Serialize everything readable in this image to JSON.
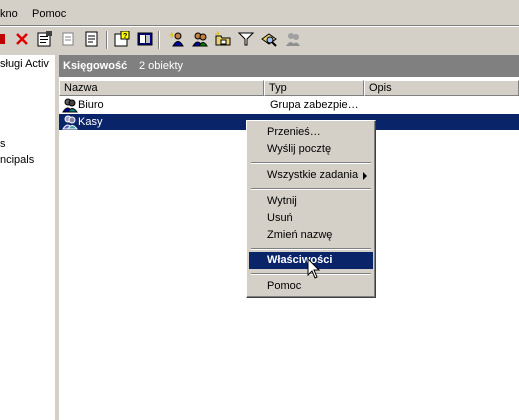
{
  "menubar": {
    "items": [
      "kno",
      "Pomoc"
    ]
  },
  "toolbar": {
    "buttons": [
      {
        "icon": "tree-toggle-icon"
      },
      {
        "icon": "delete-icon"
      },
      {
        "icon": "properties-icon"
      },
      {
        "icon": "copy-icon"
      },
      {
        "icon": "export-list-icon"
      },
      {
        "icon": "help-icon"
      },
      {
        "icon": "console-icon"
      },
      {
        "icon": "new-user-icon"
      },
      {
        "icon": "new-group-icon"
      },
      {
        "icon": "new-ou-icon"
      },
      {
        "icon": "filter-icon"
      },
      {
        "icon": "find-icon"
      },
      {
        "icon": "add-to-group-icon"
      }
    ]
  },
  "tree": {
    "items": [
      "sługi Activ",
      "s",
      "ncipals"
    ]
  },
  "panel": {
    "title": "Księgowość",
    "count": "2 obiekty",
    "columns": [
      "Nazwa",
      "Typ",
      "Opis"
    ],
    "rows": [
      {
        "name": "Biuro",
        "type": "Grupa zabezpie…",
        "desc": ""
      },
      {
        "name": "Kasy",
        "type": "",
        "desc": ""
      }
    ]
  },
  "context_menu": {
    "items": [
      "Przenieś…",
      "Wyślij pocztę",
      "Wszystkie zadania",
      "Wytnij",
      "Usuń",
      "Zmień nazwę",
      "Właściwości",
      "Pomoc"
    ],
    "active": "Właściwości"
  },
  "colors": {
    "face": "#d4d0c8",
    "selection": "#0a246a",
    "header": "#808080"
  }
}
